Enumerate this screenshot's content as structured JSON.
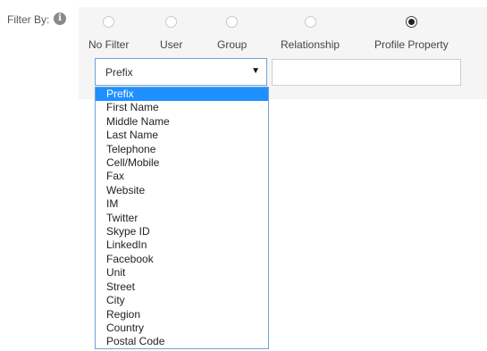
{
  "filter": {
    "label": "Filter By:",
    "info_glyph": "i",
    "radio_options": [
      {
        "label": "No Filter",
        "checked": false
      },
      {
        "label": "User",
        "checked": false
      },
      {
        "label": "Group",
        "checked": false
      },
      {
        "label": "Relationship",
        "checked": false
      },
      {
        "label": "Profile Property",
        "checked": true
      }
    ],
    "property_select": {
      "value": "Prefix",
      "options": [
        "Prefix",
        "First Name",
        "Middle Name",
        "Last Name",
        "Telephone",
        "Cell/Mobile",
        "Fax",
        "Website",
        "IM",
        "Twitter",
        "Skype ID",
        "LinkedIn",
        "Facebook",
        "Unit",
        "Street",
        "City",
        "Region",
        "Country",
        "Postal Code"
      ],
      "highlighted_index": 0
    },
    "value_input": {
      "value": "",
      "placeholder": ""
    }
  },
  "colors": {
    "accent": "#1e90ff",
    "panel_bg": "#f5f5f5",
    "focus_border": "#6fa3d9"
  },
  "icons": {
    "info": "info-icon",
    "dropdown_caret": "caret-down-icon"
  }
}
